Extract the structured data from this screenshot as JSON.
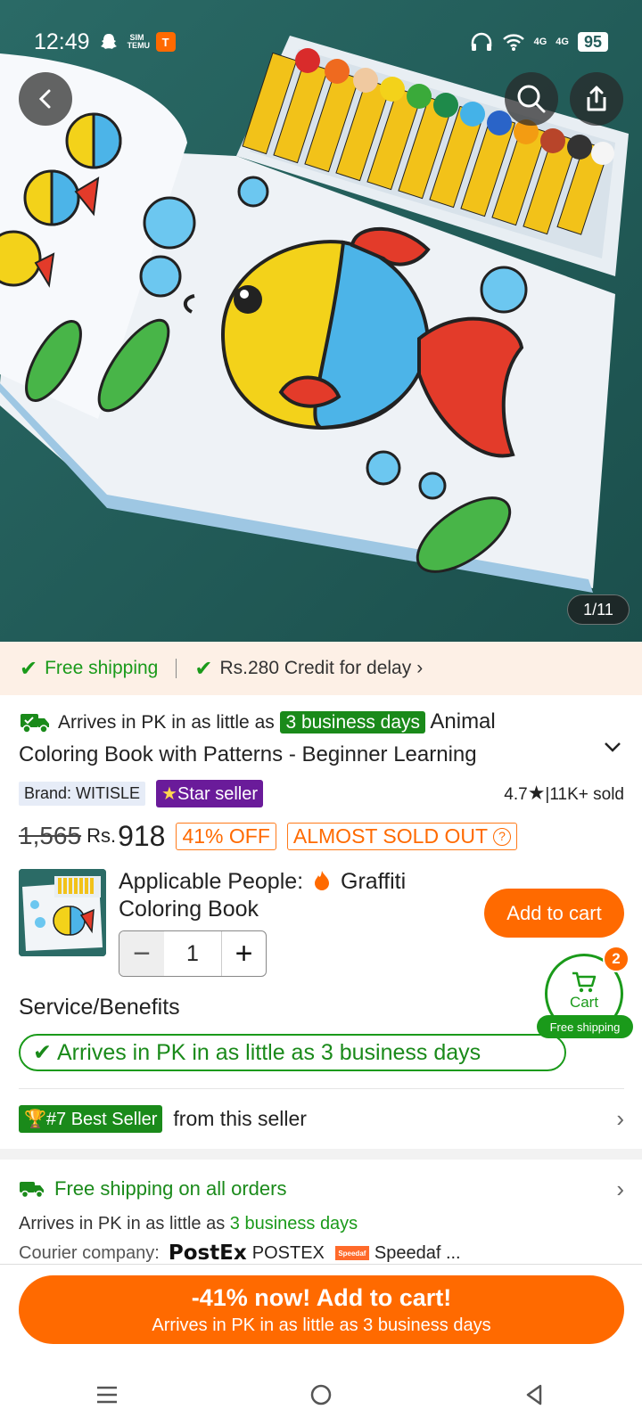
{
  "status_bar": {
    "time": "12:49",
    "mini_label": "SIM TEMU",
    "temu_glyph": "T",
    "net1": "4G",
    "net2": "4G",
    "battery": "95"
  },
  "gallery": {
    "page_indicator": "1/11"
  },
  "shipping_banner": {
    "free_shipping": "Free shipping",
    "credit": "Rs.280 Credit for delay"
  },
  "product": {
    "arrives_prefix": "Arrives in PK in as little as",
    "days_badge": "3 business days",
    "title_start": "Animal",
    "title_line2": "Coloring Book with Patterns - Beginner Learning",
    "brand": "Brand: WITISLE",
    "star_seller": "Star seller",
    "rating": "4.7",
    "sold": "11K+ sold",
    "original_price": "1,565",
    "currency": "Rs.",
    "price": "918",
    "discount": "41% OFF",
    "stock_status": "ALMOST SOLD OUT"
  },
  "variant": {
    "label": "Applicable People:",
    "value_line1": "Graffiti",
    "value_line2": "Coloring Book",
    "minus": "−",
    "quantity": "1",
    "plus": "+",
    "add_to_cart": "Add to cart"
  },
  "floating_cart": {
    "label": "Cart",
    "count": "2",
    "free_shipping": "Free shipping"
  },
  "service": {
    "title": "Service/Benefits",
    "pill": "Arrives in PK in as little as 3 business days"
  },
  "best_seller": {
    "badge": "#7 Best Seller",
    "text": "from this seller"
  },
  "shipping_info": {
    "free_all": "Free shipping on all orders",
    "arrives_prefix": "Arrives in PK in as little as",
    "arrives_days": "3 business days",
    "courier_label": "Courier company:",
    "courier_logo": "PostEx",
    "courier1": "POSTEX",
    "courier2_logo": "Speedaf",
    "courier2": "Speedaf ..."
  },
  "cta": {
    "line1": "-41% now! Add to cart!",
    "line2": "Arrives in PK in as little as 3 business days"
  },
  "colors": {
    "accent": "#ff6a00",
    "green": "#1a8a1a",
    "purple": "#6a1b9a",
    "hero_bg": "#245c5a"
  },
  "icons": [
    "back-icon",
    "search-icon",
    "share-icon",
    "check-icon",
    "truck-icon",
    "chevron-down-icon",
    "star-icon",
    "question-icon",
    "flame-icon",
    "cart-icon",
    "trophy-icon",
    "chevron-right-icon",
    "menu-icon",
    "home-icon",
    "back-triangle-icon"
  ]
}
